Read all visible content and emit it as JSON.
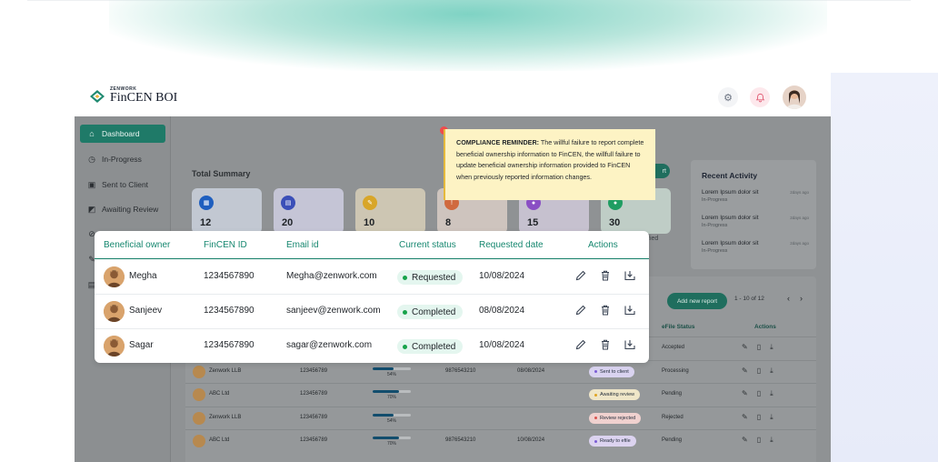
{
  "brand": {
    "small": "ZENWORK",
    "name": "FinCEN BOI",
    "color": "#1f8a70"
  },
  "header": {
    "settings_icon": "gear-icon",
    "notification_icon": "bell-icon",
    "avatar": "user-avatar"
  },
  "sidebar": {
    "items": [
      {
        "label": "Dashboard",
        "icon": "home-icon",
        "active": true
      },
      {
        "label": "In-Progress",
        "icon": "clock-icon"
      },
      {
        "label": "Sent to Client",
        "icon": "id-card-icon"
      },
      {
        "label": "Awaiting Review",
        "icon": "review-icon"
      }
    ]
  },
  "summary": {
    "title": "Total Summary",
    "cards": [
      {
        "value": "12",
        "color": "#1f5fbf",
        "bg": "#c9d3e6"
      },
      {
        "value": "20",
        "color": "#3b4fb8",
        "bg": "#cdd0e8"
      },
      {
        "value": "10",
        "color": "#d8a629",
        "bg": "#d9cfb2"
      },
      {
        "value": "8",
        "color": "#d06a3f",
        "bg": "#dccac1"
      },
      {
        "value": "15",
        "color": "#8a4fc4",
        "bg": "#d0c8de"
      },
      {
        "value": "30",
        "color": "#1f9d62",
        "bg": "#c3d8ce",
        "sub": "fied"
      }
    ],
    "export_label": "rt"
  },
  "compliance": {
    "heading": "COMPLIANCE REMINDER:",
    "text": "The willful failure to report complete beneficial ownership information to FinCEN, the willfull failure to update beneficial ownership information provided to FinCEN when previously reported information changes."
  },
  "recent_activity": {
    "title": "Recent Activity",
    "items": [
      {
        "text": "Lorem Ipsum dolor sit",
        "status": "In-Progress",
        "time": "2days ago"
      },
      {
        "text": "Lorem Ipsum dolor sit",
        "status": "In-Progress",
        "time": "2days ago"
      },
      {
        "text": "Lorem Ipsum dolor sit",
        "status": "In-Progress",
        "time": "2days ago"
      }
    ]
  },
  "clients_table": {
    "add_label": "Add new report",
    "pager": "1 - 10  of 12",
    "columns": {
      "efile": "eFile Status",
      "actions": "Actions"
    },
    "rows": [
      {
        "company": "",
        "id": "",
        "progress": "",
        "phone": "",
        "date": "",
        "status": "",
        "status_color": "",
        "efile": "Accepted"
      },
      {
        "company": "Zenwork LLB",
        "id": "123456789",
        "progress": "54%",
        "fill": 0.54,
        "phone": "9876543210",
        "date": "08/08/2024",
        "status": "Sent to client",
        "status_color": "#7c5cd6",
        "pill_bg": "#d9d3f0",
        "efile": "Processing"
      },
      {
        "company": "ABC Ltd",
        "id": "123456789",
        "progress": "70%",
        "fill": 0.7,
        "phone": "",
        "date": "",
        "status": "Awaiting review",
        "status_color": "#e0a422",
        "pill_bg": "#efe6c8",
        "efile": "Pending"
      },
      {
        "company": "Zenwork LLB",
        "id": "123456789",
        "progress": "54%",
        "fill": 0.54,
        "phone": "",
        "date": "",
        "status": "Review rejected",
        "status_color": "#d9534f",
        "pill_bg": "#f0d1cf",
        "efile": "Rejected"
      },
      {
        "company": "ABC Ltd",
        "id": "123456789",
        "progress": "70%",
        "fill": 0.7,
        "phone": "9876543210",
        "date": "10/08/2024",
        "status": "Ready to efile",
        "status_color": "#7c5cd6",
        "pill_bg": "#dcd3f0",
        "efile": "Pending"
      }
    ]
  },
  "owners_table": {
    "headers": {
      "owner": "Beneficial owner",
      "fincen": "FinCEN ID",
      "email": "Email id",
      "status": "Current status",
      "date": "Requested date",
      "actions": "Actions"
    },
    "rows": [
      {
        "name": "Megha",
        "fincen": "1234567890",
        "email": "Megha@zenwork.com",
        "status": "Requested",
        "date": "10/08/2024"
      },
      {
        "name": "Sanjeev",
        "fincen": "1234567890",
        "email": "sanjeev@zenwork.com",
        "status": "Completed",
        "date": "08/08/2024"
      },
      {
        "name": "Sagar",
        "fincen": "1234567890",
        "email": "sagar@zenwork.com",
        "status": "Completed",
        "date": "10/08/2024"
      }
    ],
    "accent": "#16876f"
  }
}
